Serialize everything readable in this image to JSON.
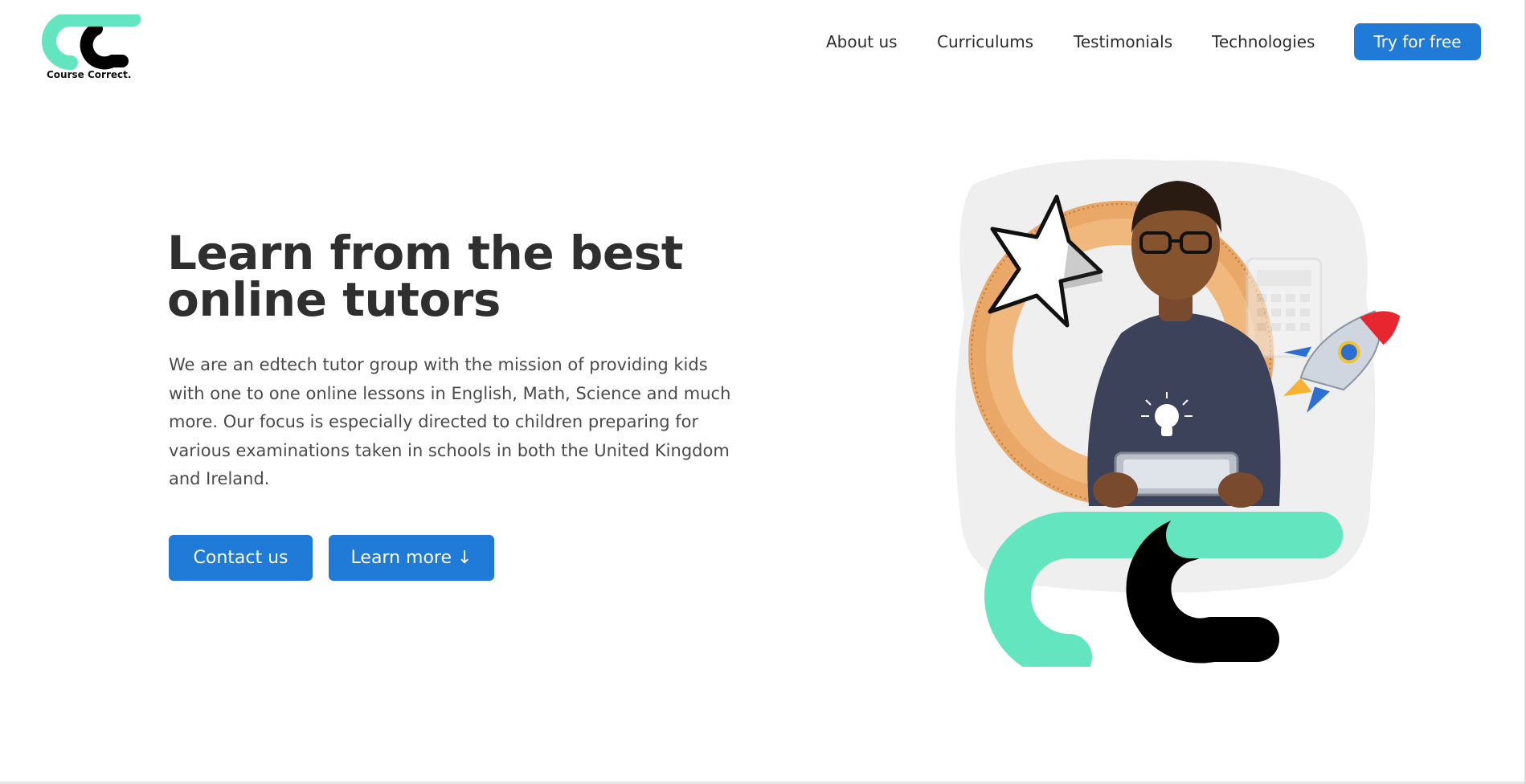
{
  "header": {
    "logo_text": "Course Correct.",
    "nav": [
      "About us",
      "Curriculums",
      "Testimonials",
      "Technologies"
    ],
    "cta_label": "Try for free"
  },
  "hero": {
    "title_line1": "Learn from the best",
    "title_line2": "online tutors",
    "body": "We are an edtech tutor group with the mission of providing kids with one to one online lessons in English, Math, Science and much more. Our focus is especially directed to children preparing for various examinations taken in schools in both the United Kingdom and Ireland.",
    "contact_label": "Contact us",
    "learn_more_label": "Learn more ↓"
  },
  "colors": {
    "accent": "#1f7ad8",
    "logo_mint": "#63e6bf",
    "logo_black": "#000000"
  }
}
